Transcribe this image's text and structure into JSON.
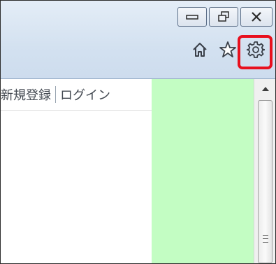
{
  "window_controls": {
    "minimize": "minimize-icon",
    "restore": "restore-icon",
    "close": "close-icon"
  },
  "toolbar": {
    "home": "home-icon",
    "favorites": "star-icon",
    "tools": "gear-icon",
    "highlight_color": "#e8101e"
  },
  "nav": {
    "register": "新規登録",
    "login": "ログイン"
  },
  "colors": {
    "chrome": "#d3e1f0",
    "green_panel": "#c3fdc3"
  }
}
